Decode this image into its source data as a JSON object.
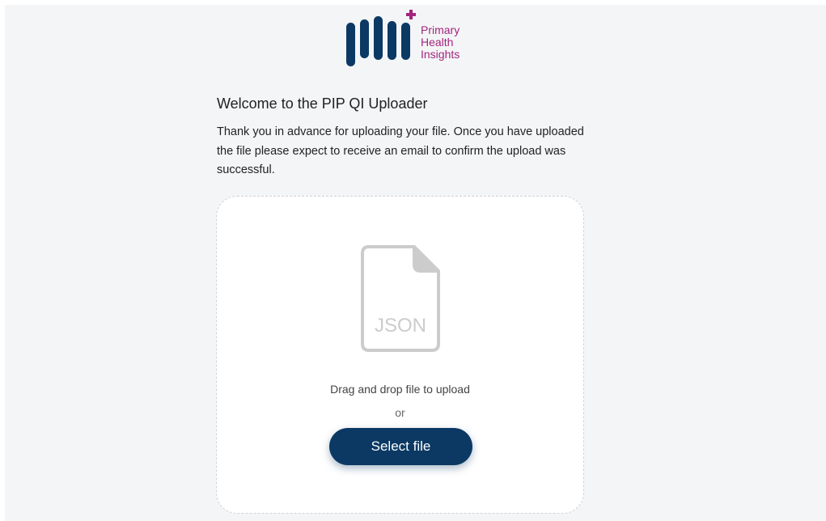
{
  "brand": {
    "line1": "Primary",
    "line2": "Health",
    "line3": "Insights",
    "primary_color": "#0b3963",
    "accent_color": "#a3257d"
  },
  "main": {
    "title": "Welcome to the PIP QI Uploader",
    "intro": "Thank you in advance for uploading your file. Once you have uploaded the file please expect to receive an email to confirm the upload was successful."
  },
  "dropzone": {
    "file_icon_label": "JSON",
    "drag_text": "Drag and drop file to upload",
    "or_text": "or",
    "select_button_label": "Select file"
  }
}
